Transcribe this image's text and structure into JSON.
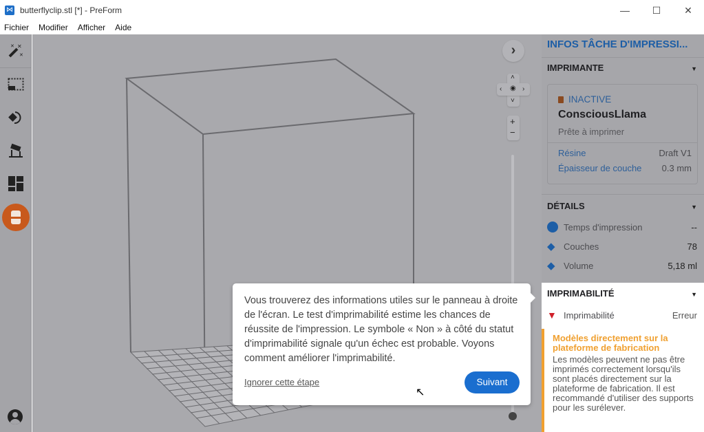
{
  "window": {
    "title": "butterflyclip.stl [*] - PreForm",
    "minimize": "—",
    "maximize": "☐",
    "close": "✕"
  },
  "menu": [
    "Fichier",
    "Modifier",
    "Afficher",
    "Aide"
  ],
  "panel": {
    "title": "INFOS TÂCHE D'IMPRESSI...",
    "printer_section": "IMPRIMANTE",
    "printer": {
      "status": "INACTIVE",
      "name": "ConsciousLlama",
      "state": "Prête à imprimer",
      "resin_label": "Résine",
      "resin_value": "Draft V1",
      "layer_label": "Épaisseur de couche",
      "layer_value": "0.3 mm"
    },
    "details_section": "DÉTAILS",
    "details": [
      {
        "label": "Temps d'impression",
        "value": "--"
      },
      {
        "label": "Couches",
        "value": "78"
      },
      {
        "label": "Volume",
        "value": "5,18 ml"
      }
    ],
    "printability_section": "IMPRIMABILITÉ",
    "printability": {
      "label": "Imprimabilité",
      "value": "Erreur"
    },
    "warning": {
      "title": "Modèles directement sur la plateforme de fabrication",
      "body": "Les modèles peuvent ne pas être imprimés correctement lorsqu'ils sont placés directement sur la plateforme de fabrication. Il est recommandé d'utiliser des supports pour les surélever."
    }
  },
  "tour": {
    "text": "Vous trouverez des informations utiles sur le panneau à droite de l'écran. Le test d'imprimabilité estime les chances de réussite de l'impression. Le symbole « Non » à côté du statut d'imprimabilité signale qu'un échec est probable. Voyons comment améliorer l'imprimabilité.",
    "skip": "Ignorer cette étape",
    "next": "Suivant"
  },
  "view": {
    "zoom_in": "+",
    "zoom_out": "−"
  },
  "colors": {
    "accent": "#1a6ecf",
    "warning": "#f0a030",
    "error": "#d0202a",
    "orange": "#c8591c"
  }
}
